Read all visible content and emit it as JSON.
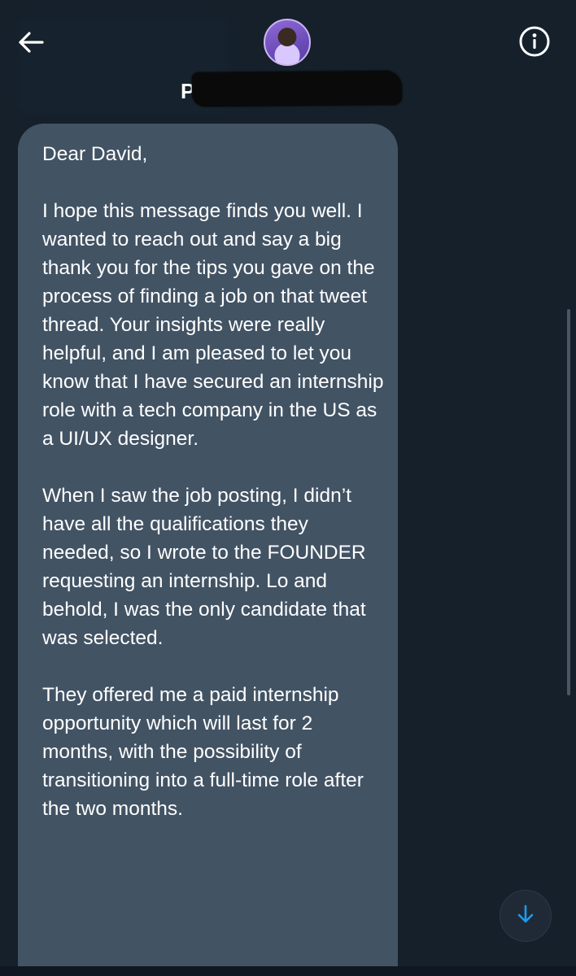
{
  "header": {
    "back_icon": "arrow-left-icon",
    "contact_name_visible": "P",
    "info_icon": "info-circle-icon"
  },
  "message": {
    "paragraphs": [
      "Dear David,",
      "I hope this message finds you well. I wanted to reach out and say a big thank you for the tips you gave on the process of finding a job on that tweet thread. Your insights were really helpful, and I am pleased to let you know that I have secured an internship role with a tech company in the US as a UI/UX designer.",
      "When I saw the job posting, I didn’t have all the qualifications they needed, so I wrote to the FOUNDER requesting an internship. Lo and behold, I was the only candidate that was selected.",
      "They offered me a paid internship opportunity which will last for 2 months, with the possibility of transitioning into a full-time role after the two months."
    ]
  },
  "scroll": {
    "down_icon": "arrow-down-icon"
  },
  "colors": {
    "background": "#15202b",
    "bubble": "#425364",
    "accent": "#1d9bf0",
    "text": "#ffffff"
  }
}
